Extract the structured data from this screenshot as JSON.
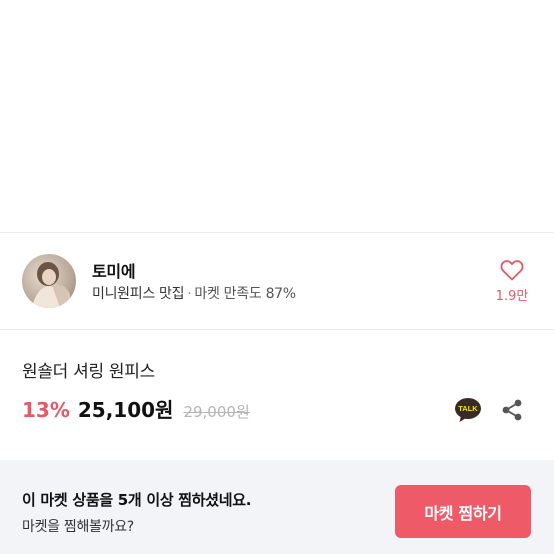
{
  "shop": {
    "name": "토미에",
    "category": "미니원피스 맛집",
    "separator": "·",
    "satisfaction": "마켓 만족도 87%",
    "like_count": "1.9만"
  },
  "product": {
    "title": "원숄더 셔링 원피스",
    "discount": "13%",
    "price": "25,100원",
    "original_price": "29,000원"
  },
  "talk_icon_text": "TALK",
  "banner": {
    "title": "이 마켓 상품을 5개 이상 찜하셨네요.",
    "subtitle": "마켓을 찜해볼까요?",
    "button_label": "마켓 찜하기"
  },
  "colors": {
    "accent": "#ee5a68",
    "discount": "#e25b67",
    "banner_bg": "#f2f4f7"
  },
  "icons": [
    "heart-icon",
    "kakaotalk-icon",
    "share-icon"
  ]
}
